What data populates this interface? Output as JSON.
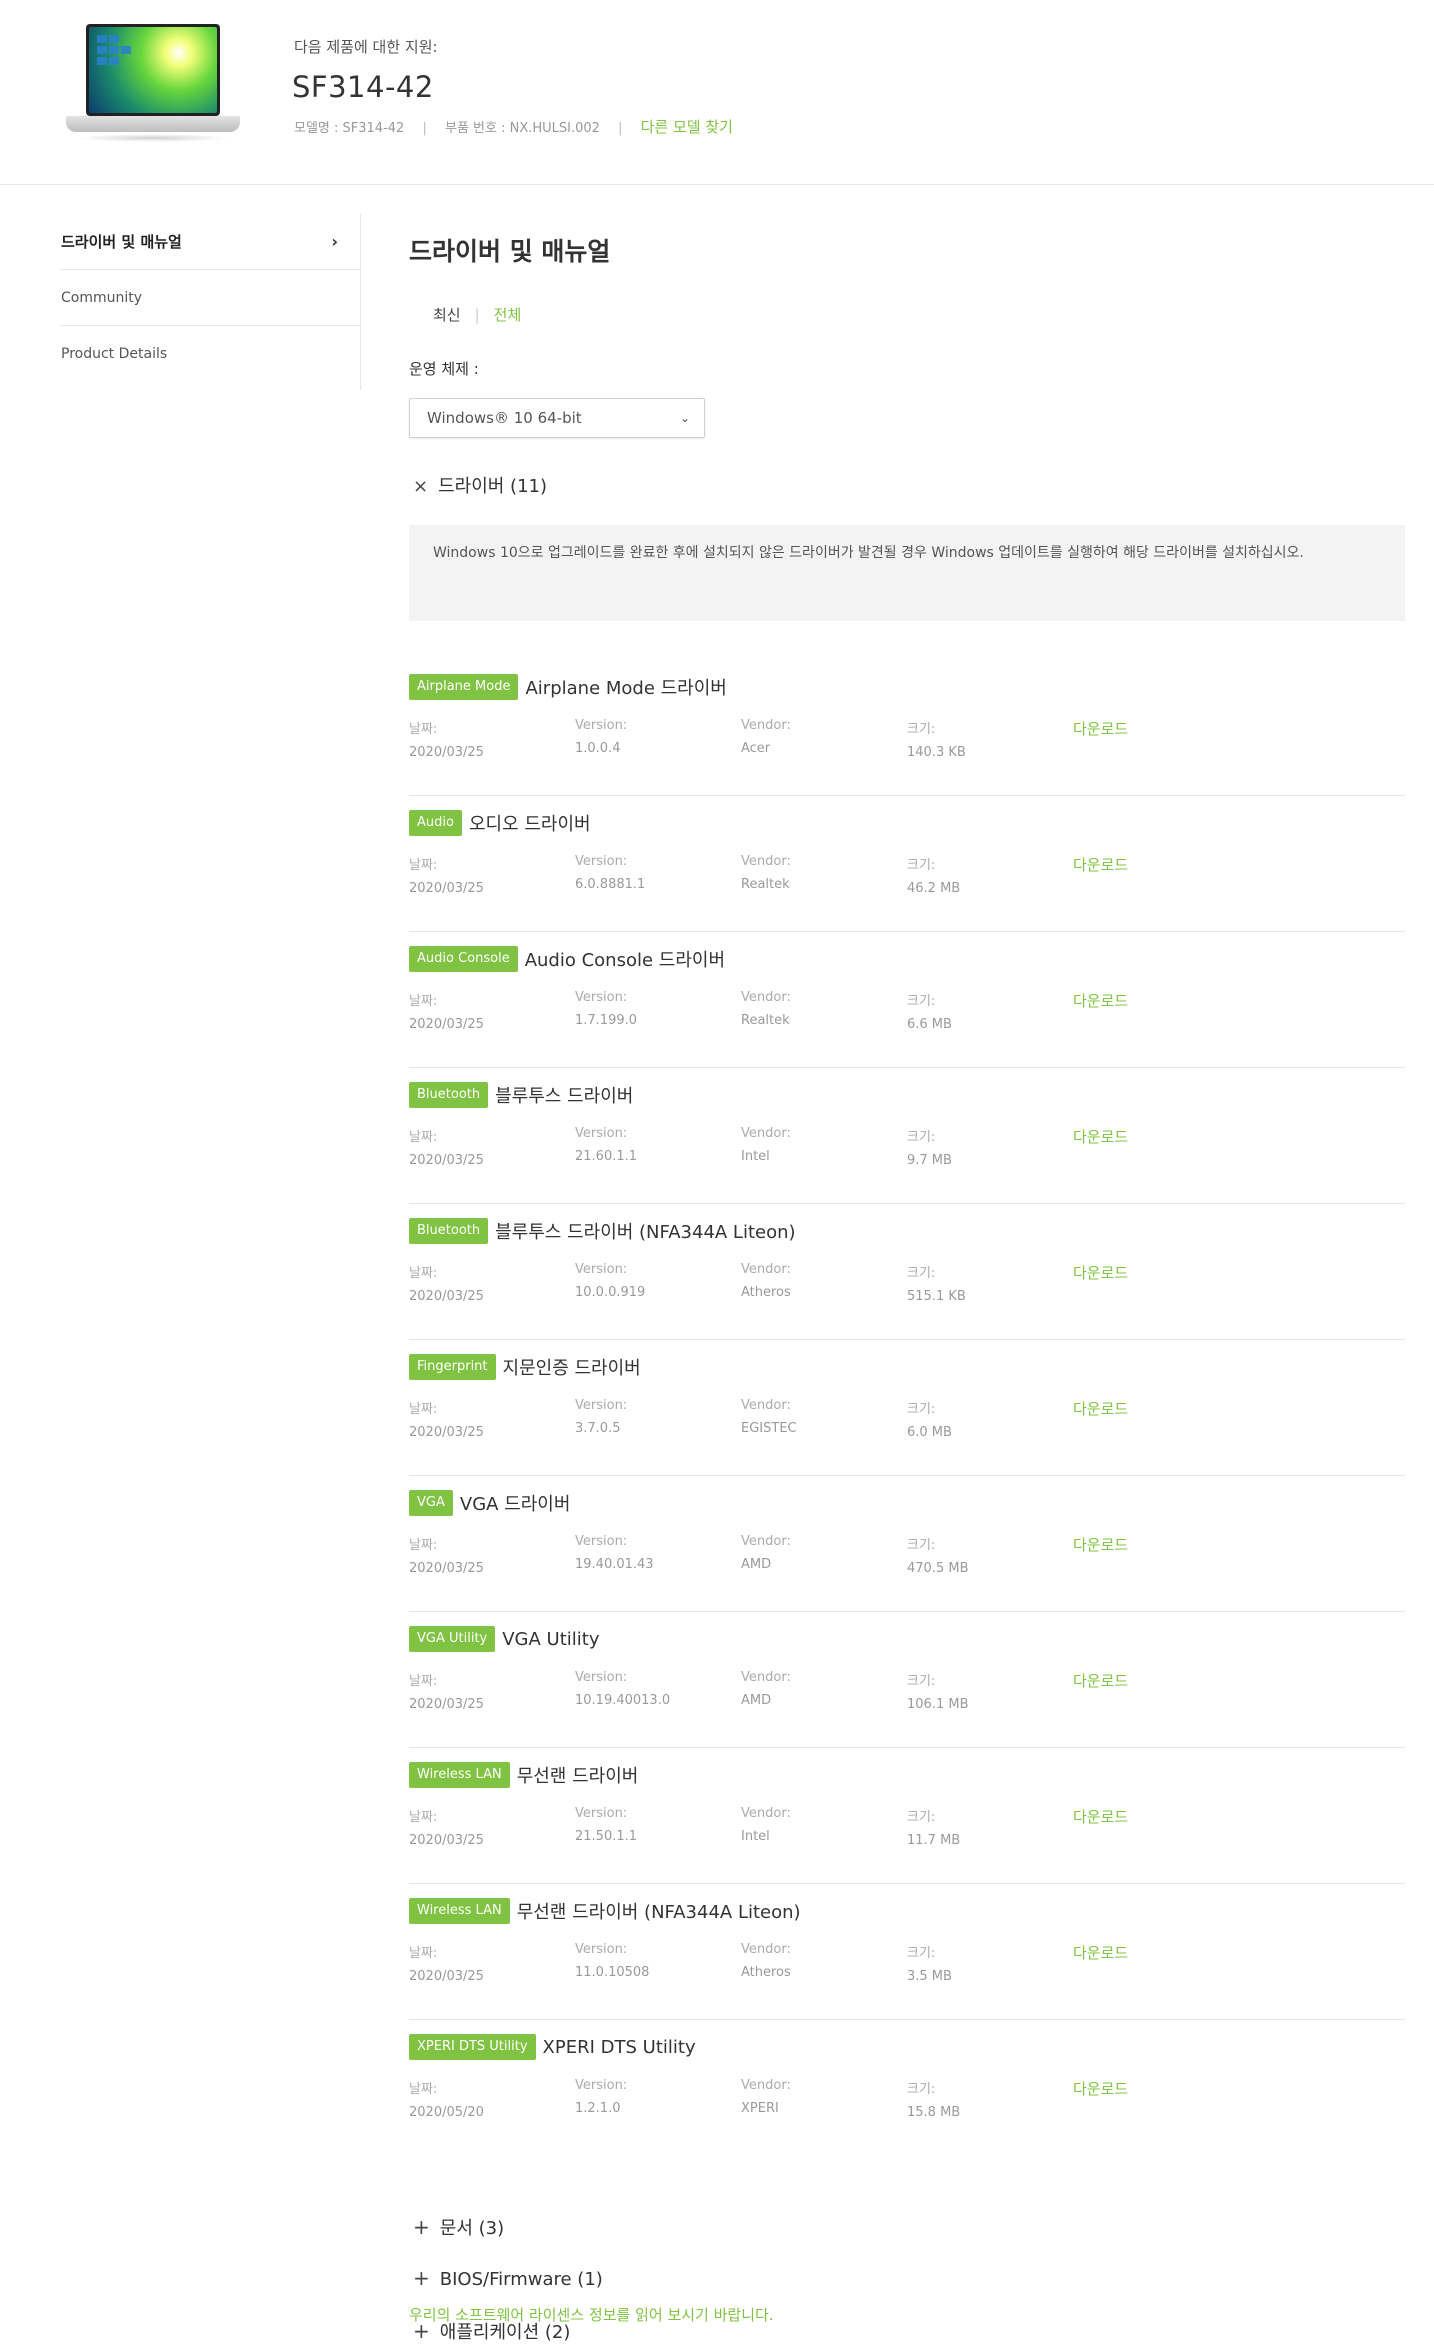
{
  "header": {
    "support_for": "다음 제품에 대한 지원:",
    "model": "SF314-42",
    "model_name": "모델명 : SF314-42",
    "part_number": "부품 번호 : NX.HULSI.002",
    "find_other": "다른 모델 찾기"
  },
  "sidebar": {
    "items": [
      {
        "label": "드라이버 및 매뉴얼"
      },
      {
        "label": "Community"
      },
      {
        "label": "Product Details"
      }
    ]
  },
  "main": {
    "title": "드라이버 및 매뉴얼",
    "tab_latest": "최신",
    "tab_all": "전체",
    "os_label": "운영 체제 :",
    "os_value": "Windows® 10 64-bit",
    "drivers_heading": "드라이버 (11)",
    "notice": "Windows 10으로 업그레이드를 완료한 후에 설치되지 않은 드라이버가 발견될 경우 Windows 업데이트를 실행하여 해당 드라이버를 설치하십시오.",
    "labels": {
      "date": "날짜:",
      "version": "Version:",
      "vendor": "Vendor:",
      "size": "크기:",
      "download": "다운로드"
    },
    "drivers": [
      {
        "badge": "Airplane Mode",
        "name": "Airplane Mode 드라이버",
        "date": "2020/03/25",
        "version": "1.0.0.4",
        "vendor": "Acer",
        "size": "140.3 KB"
      },
      {
        "badge": "Audio",
        "name": "오디오 드라이버",
        "date": "2020/03/25",
        "version": "6.0.8881.1",
        "vendor": "Realtek",
        "size": "46.2 MB"
      },
      {
        "badge": "Audio Console",
        "name": "Audio Console 드라이버",
        "date": "2020/03/25",
        "version": "1.7.199.0",
        "vendor": "Realtek",
        "size": "6.6 MB"
      },
      {
        "badge": "Bluetooth",
        "name": "블루투스 드라이버",
        "date": "2020/03/25",
        "version": "21.60.1.1",
        "vendor": "Intel",
        "size": "9.7 MB"
      },
      {
        "badge": "Bluetooth",
        "name": "블루투스 드라이버 (NFA344A Liteon)",
        "date": "2020/03/25",
        "version": "10.0.0.919",
        "vendor": "Atheros",
        "size": "515.1 KB"
      },
      {
        "badge": "Fingerprint",
        "name": "지문인증 드라이버",
        "date": "2020/03/25",
        "version": "3.7.0.5",
        "vendor": "EGISTEC",
        "size": "6.0 MB"
      },
      {
        "badge": "VGA",
        "name": "VGA 드라이버",
        "date": "2020/03/25",
        "version": "19.40.01.43",
        "vendor": "AMD",
        "size": "470.5 MB"
      },
      {
        "badge": "VGA Utility",
        "name": "VGA Utility",
        "date": "2020/03/25",
        "version": "10.19.40013.0",
        "vendor": "AMD",
        "size": "106.1 MB"
      },
      {
        "badge": "Wireless LAN",
        "name": "무선랜 드라이버",
        "date": "2020/03/25",
        "version": "21.50.1.1",
        "vendor": "Intel",
        "size": "11.7 MB"
      },
      {
        "badge": "Wireless LAN",
        "name": "무선랜 드라이버 (NFA344A Liteon)",
        "date": "2020/03/25",
        "version": "11.0.10508",
        "vendor": "Atheros",
        "size": "3.5 MB"
      },
      {
        "badge": "XPERI DTS Utility",
        "name": "XPERI DTS Utility",
        "date": "2020/05/20",
        "version": "1.2.1.0",
        "vendor": "XPERI",
        "size": "15.8 MB"
      }
    ],
    "sections": [
      {
        "label": "문서 (3)"
      },
      {
        "label": "BIOS/Firmware (1)"
      },
      {
        "label": "애플리케이션 (2)"
      }
    ],
    "license": "우리의 소프트웨어 라이센스 정보를 읽어 보시기 바랍니다."
  },
  "colors": {
    "accent": "#80c342",
    "border": "#e6e6e6",
    "notice_bg": "#f3f3f3"
  },
  "icons": {
    "sidebar_chevron": "chevron-right-icon",
    "select_chevron": "chevron-down-icon",
    "collapse": "close-icon",
    "expand": "plus-icon"
  }
}
